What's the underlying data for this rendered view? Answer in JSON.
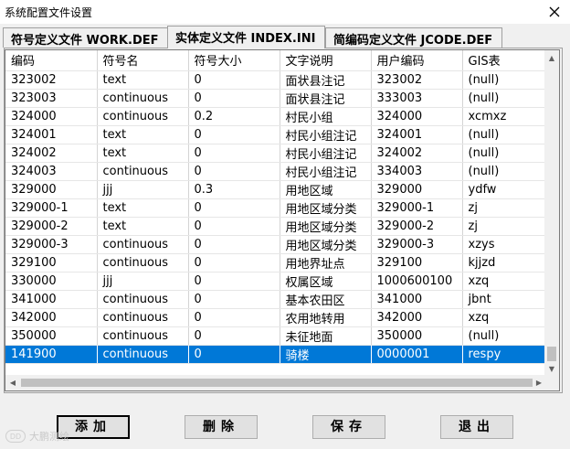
{
  "window": {
    "title": "系统配置文件设置",
    "close_icon": "close-icon"
  },
  "tabs": [
    {
      "label": "符号定义文件 WORK.DEF",
      "active": false
    },
    {
      "label": "实体定义文件 INDEX.INI",
      "active": true
    },
    {
      "label": "简编码定义文件 JCODE.DEF",
      "active": false
    }
  ],
  "grid": {
    "columns": [
      "编码",
      "符号名",
      "符号大小",
      "文字说明",
      "用户编码",
      "GIS表"
    ],
    "rows": [
      [
        "323002",
        "text",
        "0",
        "面状县注记",
        "323002",
        "(null)"
      ],
      [
        "323003",
        "continuous",
        "0",
        "面状县注记",
        "333003",
        "(null)"
      ],
      [
        "324000",
        "continuous",
        "0.2",
        "村民小组",
        "324000",
        "xcmxz"
      ],
      [
        "324001",
        "text",
        "0",
        "村民小组注记",
        "324001",
        "(null)"
      ],
      [
        "324002",
        "text",
        "0",
        "村民小组注记",
        "324002",
        "(null)"
      ],
      [
        "324003",
        "continuous",
        "0",
        "村民小组注记",
        "334003",
        "(null)"
      ],
      [
        "329000",
        "jjj",
        "0.3",
        "用地区域",
        "329000",
        "ydfw"
      ],
      [
        "329000-1",
        "text",
        "0",
        "用地区域分类",
        "329000-1",
        "zj"
      ],
      [
        "329000-2",
        "text",
        "0",
        "用地区域分类",
        "329000-2",
        "zj"
      ],
      [
        "329000-3",
        "continuous",
        "0",
        "用地区域分类",
        "329000-3",
        "xzys"
      ],
      [
        "329100",
        "continuous",
        "0",
        "用地界址点",
        "329100",
        "kjjzd"
      ],
      [
        "330000",
        "jjj",
        "0",
        "权属区域",
        "1000600100",
        "xzq"
      ],
      [
        "341000",
        "continuous",
        "0",
        "基本农田区",
        "341000",
        "jbnt"
      ],
      [
        "342000",
        "continuous",
        "0",
        "农用地转用",
        "342000",
        "xzq"
      ],
      [
        "350000",
        "continuous",
        "0",
        "未征地面",
        "350000",
        "(null)"
      ],
      [
        "141900",
        "continuous",
        "0",
        "骑楼",
        "0000001",
        "respy"
      ]
    ],
    "selected_row": 15
  },
  "buttons": {
    "add": "添加",
    "delete": "删除",
    "save": "保存",
    "exit": "退出"
  },
  "watermark": {
    "logo_text": "DD",
    "text": "大鹏测绘"
  }
}
